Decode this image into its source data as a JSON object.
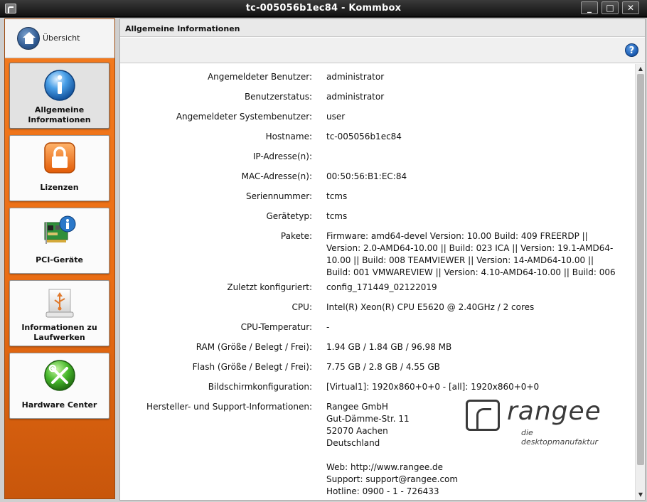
{
  "window": {
    "title": "tc-005056b1ec84 - Kommbox",
    "min_label": "_",
    "max_label": "□",
    "close_label": "✕"
  },
  "sidebar": {
    "home_label": "Übersicht",
    "items": [
      {
        "label": "Allgemeine Informationen",
        "icon": "info-icon",
        "active": true
      },
      {
        "label": "Lizenzen",
        "icon": "lock-icon",
        "active": false
      },
      {
        "label": "PCI-Geräte",
        "icon": "pci-card-icon",
        "active": false
      },
      {
        "label": "Informationen zu Laufwerken",
        "icon": "usb-drive-icon",
        "active": false
      },
      {
        "label": "Hardware Center",
        "icon": "tools-icon",
        "active": false
      }
    ]
  },
  "content": {
    "header": "Allgemeine Informationen",
    "help_label": "?",
    "rows": [
      {
        "key": "Angemeldeter Benutzer:",
        "value": "administrator"
      },
      {
        "key": "Benutzerstatus:",
        "value": "administrator"
      },
      {
        "key": "Angemeldeter Systembenutzer:",
        "value": "user"
      },
      {
        "key": "Hostname:",
        "value": "tc-005056b1ec84"
      },
      {
        "key": "IP-Adresse(n):",
        "value": ""
      },
      {
        "key": "MAC-Adresse(n):",
        "value": "00:50:56:B1:EC:84"
      },
      {
        "key": "Seriennummer:",
        "value": "tcms"
      },
      {
        "key": "Gerätetyp:",
        "value": "tcms"
      },
      {
        "key": "Pakete:",
        "value": "Firmware: amd64-devel Version: 10.00 Build: 409 FREERDP || Version: 2.0-AMD64-10.00 || Build: 023 ICA || Version: 19.1-AMD64-10.00 || Build: 008 TEAMVIEWER || Version: 14-AMD64-10.00 || Build: 001 VMWAREVIEW || Version: 4.10-AMD64-10.00 || Build: 006"
      },
      {
        "key": "Zuletzt konfiguriert:",
        "value": "config_171449_02122019"
      },
      {
        "key": "CPU:",
        "value": "Intel(R) Xeon(R) CPU E5620 @ 2.40GHz / 2 cores"
      },
      {
        "key": "CPU-Temperatur:",
        "value": "-"
      },
      {
        "key": "RAM (Größe / Belegt / Frei):",
        "value": "1.94 GB / 1.84 GB / 96.98 MB"
      },
      {
        "key": "Flash (Größe / Belegt / Frei):",
        "value": "7.75 GB / 2.8 GB / 4.55 GB"
      },
      {
        "key": "Bildschirmkonfiguration:",
        "value": "[Virtual1]: 1920x860+0+0 - [all]: 1920x860+0+0"
      }
    ],
    "support": {
      "key": "Hersteller- und Support-Informationen:",
      "lines": [
        "Rangee GmbH",
        "Gut-Dämme-Str. 11",
        "52070 Aachen",
        "Deutschland",
        "",
        "Web: http://www.rangee.de",
        "Support: support@rangee.com",
        "Hotline: 0900 - 1 - 726433"
      ]
    },
    "logo": {
      "wordmark": "rangee",
      "tagline": "die desktopmanufaktur"
    }
  }
}
